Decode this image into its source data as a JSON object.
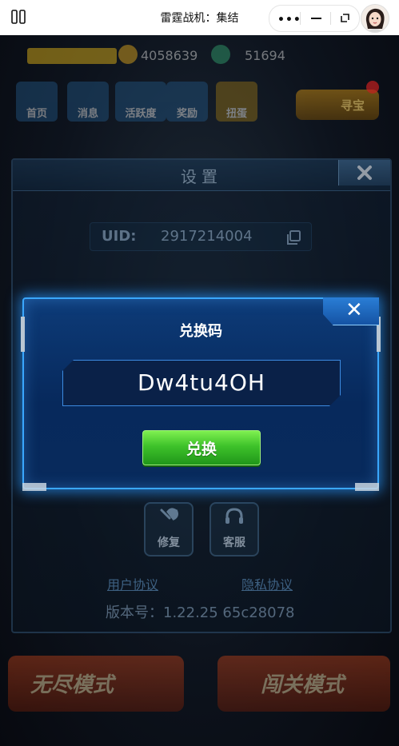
{
  "topbar": {
    "title": "雷霆战机：集结",
    "more_label": "•••"
  },
  "hud": {
    "coins": "4058639",
    "gems": "51694"
  },
  "nav": {
    "items": [
      {
        "label": "首页"
      },
      {
        "label": "消息"
      },
      {
        "label": "活跃度"
      },
      {
        "label": "奖励"
      },
      {
        "label": "扭蛋"
      }
    ],
    "gold_button": "寻宝"
  },
  "settings": {
    "title": "设置",
    "uid_label": "UID:",
    "uid_value": "2917214004",
    "repair_label": "修复",
    "service_label": "客服",
    "user_agreement": "用户协议",
    "privacy_agreement": "隐私协议",
    "version": "版本号：1.22.25  65c28078"
  },
  "modes": {
    "endless": "无尽模式",
    "stage": "闯关模式"
  },
  "redeem_dialog": {
    "title": "兑换码",
    "code_value": "Dw4tu4OH",
    "redeem_button": "兑换",
    "close_symbol": "✕"
  },
  "colors": {
    "dialog_border": "#3aa7ff",
    "button_green": "#3ec22a",
    "dialog_bg": "#0d3b78"
  }
}
